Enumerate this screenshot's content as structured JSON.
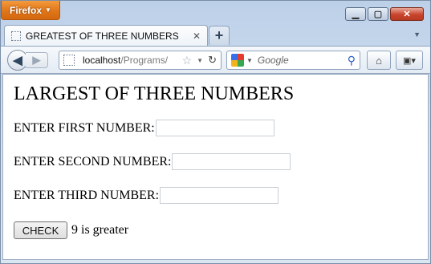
{
  "browser": {
    "menu_label": "Firefox",
    "tab_title": "GREATEST OF THREE NUMBERS",
    "url_host": "localhost",
    "url_path": "/Programs/",
    "search_placeholder": "Google"
  },
  "page": {
    "heading": "LARGEST OF THREE NUMBERS",
    "first_label": "ENTER FIRST NUMBER:",
    "second_label": "ENTER SECOND NUMBER:",
    "third_label": "ENTER THIRD NUMBER:",
    "first_value": "",
    "second_value": "",
    "third_value": "",
    "check_label": "CHECK",
    "result_text": "9 is greater"
  }
}
